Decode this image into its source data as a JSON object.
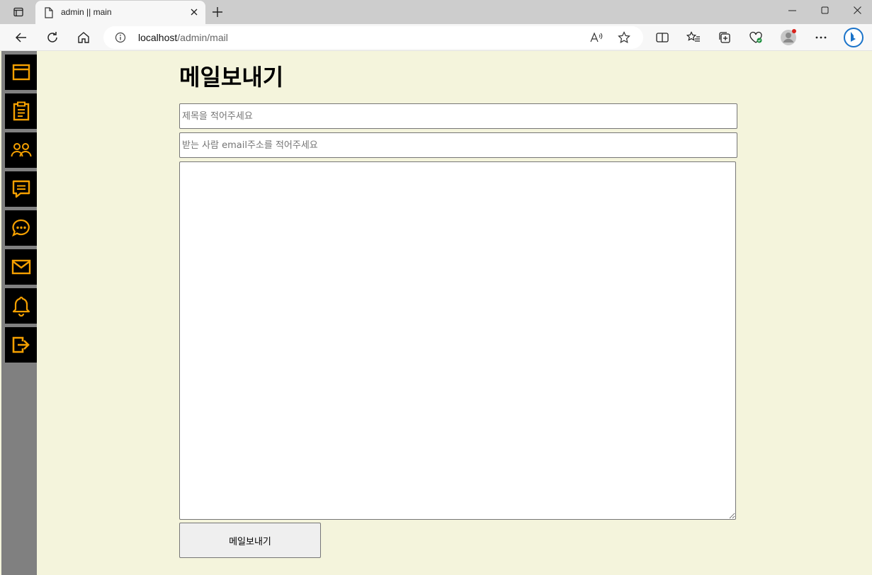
{
  "browser": {
    "tab_title": "admin || main",
    "url_host": "localhost",
    "url_path": "/admin/mail"
  },
  "sidebar": {
    "accent_color": "#f5a000",
    "items": [
      {
        "icon": "window-icon"
      },
      {
        "icon": "clipboard-icon"
      },
      {
        "icon": "users-icon"
      },
      {
        "icon": "message-icon"
      },
      {
        "icon": "chat-bubble-icon"
      },
      {
        "icon": "mail-icon"
      },
      {
        "icon": "bell-icon"
      },
      {
        "icon": "logout-icon"
      }
    ]
  },
  "main": {
    "title": "메일보내기",
    "subject_placeholder": "제목을 적어주세요",
    "recipient_placeholder": "받는 사람 email주소를 적어주세요",
    "body_value": "",
    "send_label": "메일보내기"
  }
}
